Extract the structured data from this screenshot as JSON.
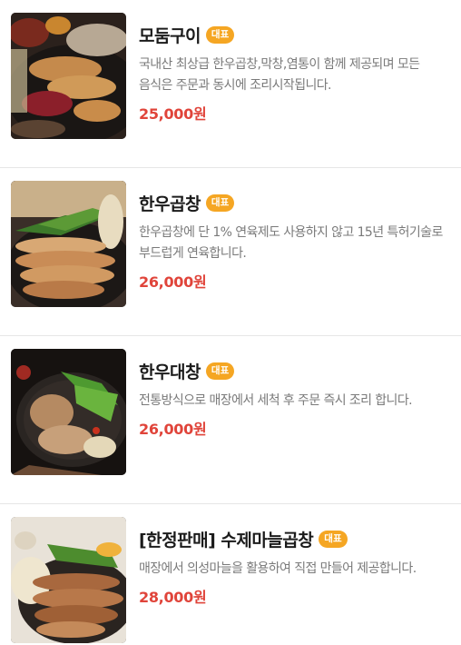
{
  "menu": {
    "items": [
      {
        "name": "모둠구이",
        "badge": "대표",
        "description": "국내산 최상급 한우곱창,막창,염통이 함께 제공되며 모든 음식은 주문과 동시에 조리시작됩니다.",
        "price": "25,000원"
      },
      {
        "name": "한우곱창",
        "badge": "대표",
        "description": "한우곱창에 단 1% 연육제도 사용하지 않고 15년 특허기술로 부드럽게 연육합니다.",
        "price": "26,000원"
      },
      {
        "name": "한우대창",
        "badge": "대표",
        "description": "전통방식으로 매장에서 세척 후 주문 즉시 조리 합니다.",
        "price": "26,000원"
      },
      {
        "name": "[한정판매] 수제마늘곱창",
        "badge": "대표",
        "description": "매장에서 의성마늘을 활용하여 직접 만들어 제공합니다.",
        "price": "28,000원"
      }
    ]
  },
  "colors": {
    "badge": "#f5a623",
    "price": "#e0443a",
    "title": "#1b1b1b",
    "description": "#7a7a7a"
  }
}
